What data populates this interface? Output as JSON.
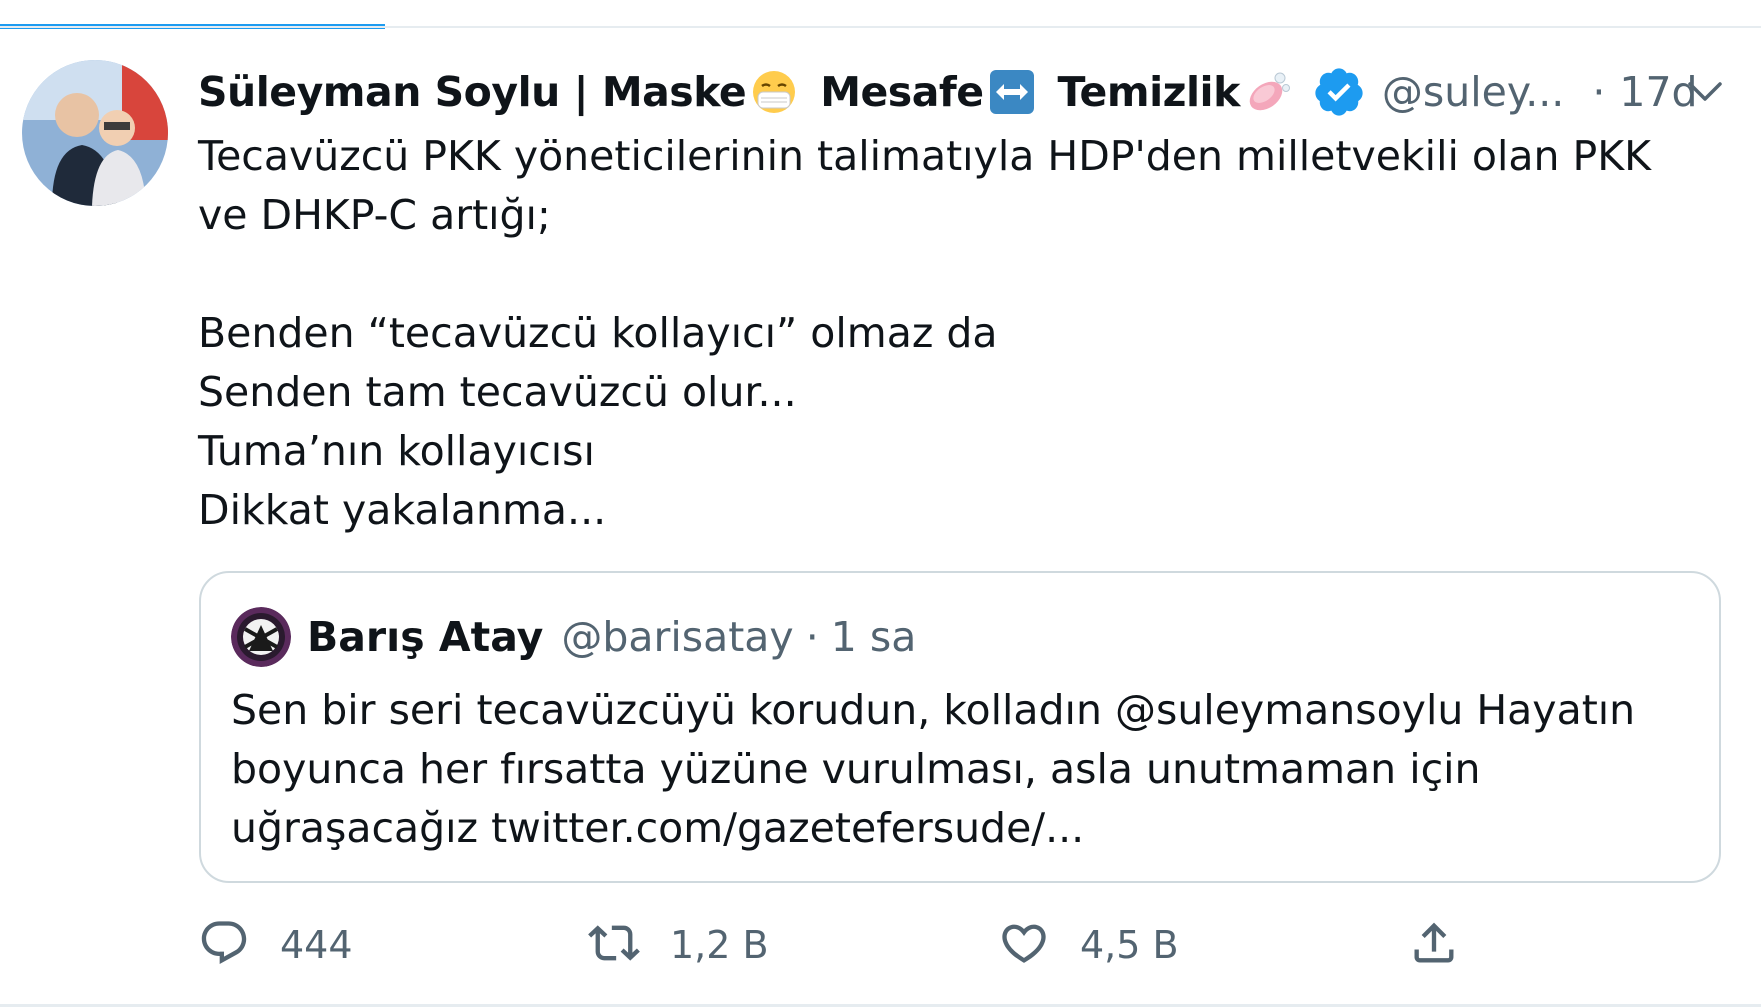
{
  "tweet": {
    "author_name": "Süleyman Soylu | Maske",
    "name_part_2": "Mesafe",
    "name_part_3": "Temizlik",
    "handle": "@suley...",
    "separator": "·",
    "time": "17d",
    "text": "Tecavüzcü PKK yöneticilerinin talimatıyla HDP'den milletvekili olan PKK ve DHKP-C artığı;\n\nBenden “tecavüzcü kollayıcı” olmaz da\nSenden tam tecavüzcü olur...\nTuma’nın kollayıcısı\nDikkat yakalanma..."
  },
  "quoted": {
    "name": "Barış Atay",
    "handle": "@barisatay",
    "separator": "·",
    "time": "1 sa",
    "text": "Sen bir seri tecavüzcüyü korudun, kolladın @suleymansoylu Hayatın boyunca her fırsatta yüzüne vurulması, asla unutmaman için uğraşacağız twitter.com/gazetefersude/..."
  },
  "actions": {
    "reply_count": "444",
    "retweet_count": "1,2 B",
    "like_count": "4,5 B"
  },
  "icons": {
    "emoji_1": "face-with-medical-mask-icon",
    "emoji_2": "left-right-arrow-icon",
    "emoji_3": "soap-icon",
    "verified": "verified-badge-icon",
    "caret": "chevron-down-icon",
    "reply": "reply-icon",
    "retweet": "retweet-icon",
    "like": "heart-icon",
    "share": "share-icon"
  },
  "colors": {
    "accent": "#1d9bf0",
    "text": "#0f1419",
    "secondary_text": "#536471",
    "border": "#cfd9de"
  }
}
